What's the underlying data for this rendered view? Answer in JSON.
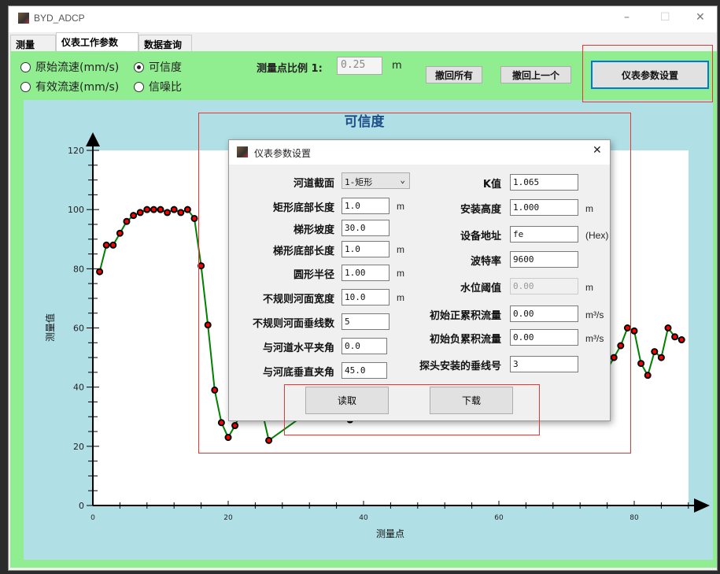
{
  "window": {
    "title": "BYD_ADCP",
    "minimize": "–",
    "maximize": "☐",
    "close": "✕"
  },
  "tabs": [
    {
      "label": "测量"
    },
    {
      "label": "仪表工作参数",
      "active": true
    },
    {
      "label": "数据查询"
    }
  ],
  "toolbar": {
    "radios": [
      {
        "label": "原始流速(mm/s)",
        "checked": false
      },
      {
        "label": "可信度",
        "checked": true
      },
      {
        "label": "有效流速(mm/s)",
        "checked": false
      },
      {
        "label": "信噪比",
        "checked": false
      }
    ],
    "ratio_label": "测量点比例 1:",
    "ratio_value": "0.25",
    "ratio_unit": "m",
    "undo_all": "撤回所有",
    "undo_last": "撤回上一个",
    "settings": "仪表参数设置"
  },
  "chart_data": {
    "type": "line",
    "title": "可信度",
    "xlabel": "测量点",
    "ylabel": "测量值",
    "xlim": [
      0,
      88
    ],
    "ylim": [
      0,
      120
    ],
    "xticks": [
      0,
      20,
      40,
      60,
      80
    ],
    "yticks": [
      0,
      20,
      40,
      60,
      80,
      100,
      120
    ],
    "line_color": "#008000",
    "marker_color": "#ff0000",
    "x": [
      1,
      2,
      3,
      4,
      5,
      6,
      7,
      8,
      9,
      10,
      11,
      12,
      13,
      14,
      15,
      16,
      17,
      18,
      19,
      20,
      21,
      22,
      25,
      26,
      37,
      38,
      39,
      76,
      77,
      78,
      79,
      80,
      81,
      82,
      83,
      84,
      85,
      86,
      87
    ],
    "y": [
      79,
      88,
      88,
      92,
      96,
      98,
      99,
      100,
      100,
      100,
      99,
      100,
      99,
      100,
      97,
      81,
      61,
      39,
      28,
      23,
      27,
      32,
      32,
      22,
      40,
      29,
      40,
      46,
      50,
      54,
      60,
      59,
      48,
      44,
      52,
      50,
      60,
      57,
      56
    ]
  },
  "dialog": {
    "title": "仪表参数设置",
    "close": "✕",
    "left": [
      {
        "label": "河道截面",
        "value": "1-矩形",
        "type": "select"
      },
      {
        "label": "矩形底部长度",
        "value": "1.0",
        "unit": "m"
      },
      {
        "label": "梯形坡度",
        "value": "30.0"
      },
      {
        "label": "梯形底部长度",
        "value": "1.0",
        "unit": "m"
      },
      {
        "label": "圆形半径",
        "value": "1.00",
        "unit": "m"
      },
      {
        "label": "不规则河面宽度",
        "value": "10.0",
        "unit": "m"
      },
      {
        "label": "不规则河面垂线数",
        "value": "5"
      },
      {
        "label": "与河道水平夹角",
        "value": "0.0"
      },
      {
        "label": "与河底垂直夹角",
        "value": "45.0"
      }
    ],
    "right": [
      {
        "label": "K值",
        "value": "1.065"
      },
      {
        "label": "安装高度",
        "value": "1.000",
        "unit": "m"
      },
      {
        "label": "设备地址",
        "value": "fe",
        "unit": "(Hex)"
      },
      {
        "label": "波特率",
        "value": "9600"
      },
      {
        "label": "水位阈值",
        "value": "0.00",
        "unit": "m",
        "disabled": true
      },
      {
        "label": "初始正累积流量",
        "value": "0.00",
        "unit": "m³/s"
      },
      {
        "label": "初始负累积流量",
        "value": "0.00",
        "unit": "m³/s"
      },
      {
        "label": "探头安装的垂线号",
        "value": "3"
      }
    ],
    "read": "读取",
    "download": "下载"
  }
}
